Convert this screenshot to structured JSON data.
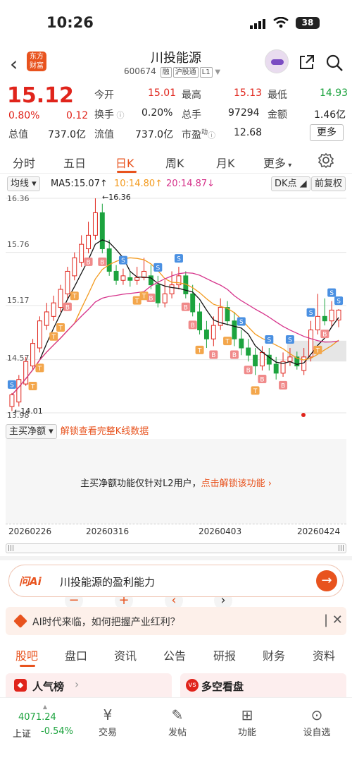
{
  "status": {
    "time": "10:26",
    "battery": "38"
  },
  "header": {
    "name": "川投能源",
    "code": "600674",
    "tags": [
      "融",
      "沪股通",
      "L1"
    ],
    "logo_line1": "东方",
    "logo_line2": "财富"
  },
  "quote": {
    "price": "15.12",
    "pct": "0.80%",
    "chg": "0.12",
    "labels": {
      "open": "今开",
      "high": "最高",
      "low": "最低",
      "turnover": "换手",
      "volume": "总手",
      "amount": "金额",
      "mktcap": "总值",
      "float": "流值",
      "pe": "市盈"
    },
    "values": {
      "open": "15.01",
      "high": "15.13",
      "low": "14.93",
      "turnover": "0.20%",
      "volume": "97294",
      "amount": "1.46亿",
      "mktcap": "737.0亿",
      "float": "737.0亿",
      "pe": "12.68"
    },
    "pe_sup": "动",
    "more": "更多"
  },
  "tabs": [
    "分时",
    "五日",
    "日K",
    "周K",
    "月K",
    "更多"
  ],
  "active_tab": "日K",
  "ma": {
    "selector": "均线",
    "ma5": "MA5:15.07",
    "ma10": "10:14.80",
    "ma20": "20:14.87",
    "dk": "DK点",
    "fq": "前复权"
  },
  "chart_data": {
    "type": "candlestick",
    "y_ticks": [
      "16.36",
      "15.76",
      "15.17",
      "14.57",
      "13.98"
    ],
    "ylim": [
      13.98,
      16.36
    ],
    "max_label": "16.36",
    "min_label": "14.01",
    "colors": {
      "up": "#e0241b",
      "down": "#1ca33e",
      "ma5": "#111111",
      "ma10": "#f39a1e",
      "ma20": "#d6338b"
    },
    "candles": [
      [
        14.05,
        14.18,
        14.2,
        14.0
      ],
      [
        14.1,
        14.35,
        14.4,
        14.05
      ],
      [
        14.3,
        14.55,
        14.6,
        14.28
      ],
      [
        14.5,
        14.75,
        14.8,
        14.45
      ],
      [
        14.7,
        15.0,
        15.05,
        14.65
      ],
      [
        14.95,
        15.1,
        15.2,
        14.9
      ],
      [
        15.05,
        15.2,
        15.28,
        15.0
      ],
      [
        15.15,
        15.35,
        15.4,
        15.1
      ],
      [
        15.3,
        15.55,
        15.6,
        15.25
      ],
      [
        15.5,
        15.7,
        15.76,
        15.45
      ],
      [
        15.65,
        15.85,
        15.95,
        15.6
      ],
      [
        15.8,
        15.95,
        16.1,
        15.75
      ],
      [
        15.95,
        16.2,
        16.36,
        15.9
      ],
      [
        16.2,
        15.8,
        16.3,
        15.75
      ],
      [
        15.8,
        15.55,
        15.9,
        15.5
      ],
      [
        15.55,
        15.45,
        15.62,
        15.4
      ],
      [
        15.45,
        15.5,
        15.58,
        15.4
      ],
      [
        15.48,
        15.45,
        15.55,
        15.38
      ],
      [
        15.45,
        15.48,
        15.6,
        15.4
      ],
      [
        15.48,
        15.55,
        15.7,
        15.45
      ],
      [
        15.5,
        15.4,
        15.62,
        15.35
      ],
      [
        15.4,
        15.2,
        15.5,
        15.15
      ],
      [
        15.2,
        15.3,
        15.45,
        15.15
      ],
      [
        15.3,
        15.4,
        15.55,
        15.25
      ],
      [
        15.4,
        15.5,
        15.6,
        15.35
      ],
      [
        15.5,
        15.3,
        15.55,
        15.25
      ],
      [
        15.3,
        15.1,
        15.4,
        15.05
      ],
      [
        15.1,
        14.9,
        15.2,
        14.85
      ],
      [
        14.9,
        14.8,
        15.0,
        14.7
      ],
      [
        14.8,
        14.95,
        15.05,
        14.72
      ],
      [
        14.95,
        15.15,
        15.25,
        14.9
      ],
      [
        15.15,
        15.0,
        15.22,
        14.95
      ],
      [
        15.0,
        14.8,
        15.1,
        14.72
      ],
      [
        14.8,
        14.7,
        14.9,
        14.62
      ],
      [
        14.7,
        14.62,
        14.8,
        14.55
      ],
      [
        14.62,
        14.5,
        14.7,
        14.4
      ],
      [
        14.5,
        14.65,
        14.72,
        14.45
      ],
      [
        14.62,
        14.52,
        14.7,
        14.45
      ],
      [
        14.52,
        14.42,
        14.6,
        14.35
      ],
      [
        14.42,
        14.55,
        14.65,
        14.38
      ],
      [
        14.55,
        14.6,
        14.7,
        14.5
      ],
      [
        14.6,
        14.5,
        14.66,
        14.46
      ],
      [
        14.45,
        14.6,
        14.7,
        14.4
      ],
      [
        14.6,
        14.9,
        15.0,
        14.55
      ],
      [
        14.9,
        15.05,
        15.3,
        14.85
      ],
      [
        15.05,
        15.0,
        15.25,
        14.95
      ],
      [
        15.0,
        15.12,
        15.22,
        14.93
      ],
      [
        15.01,
        15.12,
        15.13,
        14.93
      ]
    ]
  },
  "signals": {
    "s": "S",
    "b": "B",
    "t": "T"
  },
  "netflow": {
    "selector": "主买净额",
    "unlock": "解锁查看完整K线数据",
    "msg": "主买净额功能仅针对L2用户，",
    "cta": "点击解锁该功能"
  },
  "dates": [
    "20260226",
    "20260316",
    "20260403",
    "20260424"
  ],
  "ask": {
    "brand": "问Ai",
    "text": "川投能源的盈利能力"
  },
  "ai_banner": {
    "text": "AI时代来临，如何把握产业红利？"
  },
  "bottom_tabs": [
    "股吧",
    "盘口",
    "资讯",
    "公告",
    "研报",
    "财务",
    "资料"
  ],
  "cards": [
    "人气榜",
    "多空看盘"
  ],
  "nav": {
    "index_value": "4071.24",
    "index_name": "上证",
    "index_pct": "-0.54%",
    "items": [
      "交易",
      "发帖",
      "功能",
      "设自选"
    ]
  }
}
